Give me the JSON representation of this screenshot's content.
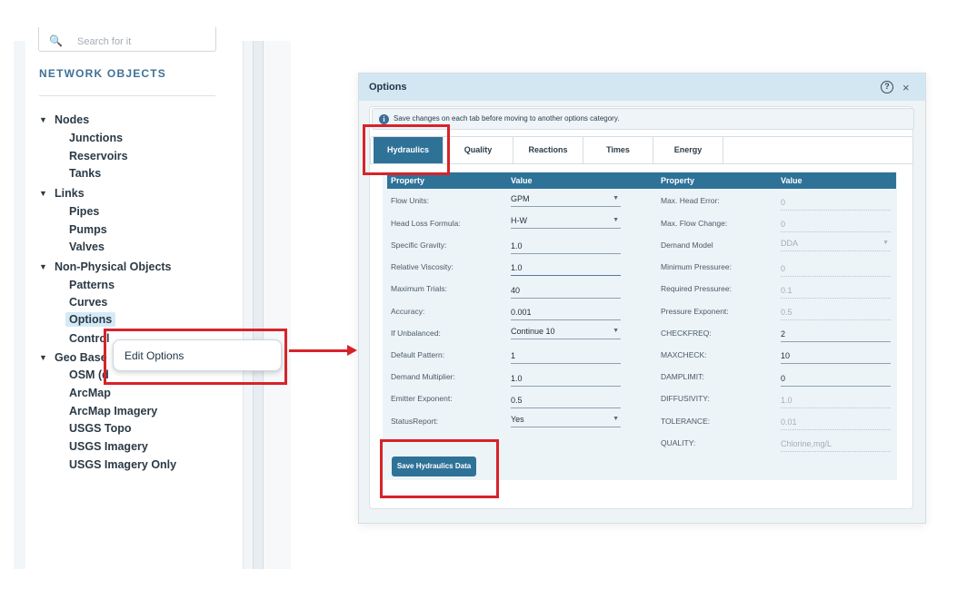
{
  "sidebar": {
    "search_placeholder": "Search for it",
    "section_title": "NETWORK OBJECTS",
    "nodes": {
      "label": "Nodes",
      "children": [
        "Junctions",
        "Reservoirs",
        "Tanks"
      ]
    },
    "links": {
      "label": "Links",
      "children": [
        "Pipes",
        "Pumps",
        "Valves"
      ]
    },
    "non_physical": {
      "label": "Non-Physical Objects",
      "children": [
        "Patterns",
        "Curves",
        "Options",
        "Controls"
      ]
    },
    "geo_base": {
      "label": "Geo Base",
      "children": [
        "OSM (d",
        "ArcMap",
        "ArcMap Imagery",
        "USGS Topo",
        "USGS Imagery",
        "USGS Imagery Only"
      ]
    }
  },
  "context_menu": {
    "edit_options": "Edit Options"
  },
  "colors": {
    "accent": "#2f7298",
    "highlight": "#d8222a",
    "header": "#d3e7f3"
  },
  "dialog": {
    "title": "Options",
    "help_glyph": "?",
    "close_glyph": "×",
    "info": "Save changes on each tab before moving to another options category.",
    "tabs": [
      "Hydraulics",
      "Quality",
      "Reactions",
      "Times",
      "Energy"
    ],
    "active_tab": "Hydraulics",
    "headers": {
      "property": "Property",
      "value": "Value"
    },
    "left_rows": [
      {
        "label": "Flow Units:",
        "value": "GPM"
      },
      {
        "label": "Head Loss Formula:",
        "value": "H-W"
      },
      {
        "label": "Specific Gravity:",
        "value": "1.0"
      },
      {
        "label": "Relative Viscosity:",
        "value": "1.0"
      },
      {
        "label": "Maximum Trials:",
        "value": "40"
      },
      {
        "label": "Accuracy:",
        "value": "0.001"
      },
      {
        "label": "If Unbalanced:",
        "value": "Continue 10"
      },
      {
        "label": "Default Pattern:",
        "value": "1"
      },
      {
        "label": "Demand Multiplier:",
        "value": "1.0"
      },
      {
        "label": "Emitter Exponent:",
        "value": "0.5"
      },
      {
        "label": "StatusReport:",
        "value": "Yes"
      }
    ],
    "right_rows": [
      {
        "label": "Max. Head Error:",
        "value": "0"
      },
      {
        "label": "Max. Flow Change:",
        "value": "0"
      },
      {
        "label": "Demand Model",
        "value": "DDA"
      },
      {
        "label": "Minimum Pressuree:",
        "value": "0"
      },
      {
        "label": "Required Pressuree:",
        "value": "0.1"
      },
      {
        "label": "Pressure Exponent:",
        "value": "0.5"
      },
      {
        "label": "CHECKFREQ:",
        "value": "2"
      },
      {
        "label": "MAXCHECK:",
        "value": "10"
      },
      {
        "label": "DAMPLIMIT:",
        "value": "0"
      },
      {
        "label": "DIFFUSIVITY:",
        "value": "1.0"
      },
      {
        "label": "TOLERANCE:",
        "value": "0.01"
      },
      {
        "label": "QUALITY:",
        "value": "Chlorine,mg/L"
      }
    ],
    "save_button": "Save Hydraulics Data"
  }
}
